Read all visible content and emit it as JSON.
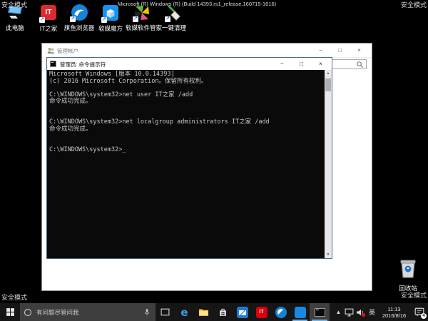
{
  "desktop": {
    "safe_mode_label": "安全模式",
    "build_text": "Microsoft (R) Windows (R) (Build 14393.rs1_release.160715-1616)",
    "icons": [
      {
        "label": "此电脑"
      },
      {
        "label": "IT之家",
        "glyph": "IT"
      },
      {
        "label": "旗鱼浏览器"
      },
      {
        "label": "软媒魔方"
      },
      {
        "label": "软媒软件管家"
      },
      {
        "label": "一键清理"
      }
    ],
    "recycle_bin_label": "回收站"
  },
  "accounts_window": {
    "title": "管理帐户",
    "controls": {
      "minimize": "−",
      "maximize": "□",
      "close": "×"
    }
  },
  "cmd_window": {
    "title": "管理员: 命令提示符",
    "controls": {
      "minimize": "−",
      "maximize": "□",
      "close": "×"
    },
    "lines": [
      "Microsoft Windows [版本 10.0.14393]",
      "(c) 2016 Microsoft Corporation。保留所有权利。",
      "",
      "C:\\WINDOWS\\system32>net user IT之家 /add",
      "命令成功完成。",
      "",
      "",
      "C:\\WINDOWS\\system32>net localgroup administrators IT之家 /add",
      "命令成功完成。",
      "",
      "",
      "C:\\WINDOWS\\system32>_"
    ]
  },
  "taskbar": {
    "search_placeholder": "有问题尽管问我",
    "edge_glyph": "e",
    "ithome_glyph": "IT"
  },
  "tray": {
    "language_indicator": "英",
    "time": "11:13",
    "date": "2016/8/16",
    "notification_badge": "4"
  },
  "colors": {
    "accent_blue": "#0078d7",
    "ithome_red": "#d6000f",
    "taskbar_bg": "#161616"
  }
}
